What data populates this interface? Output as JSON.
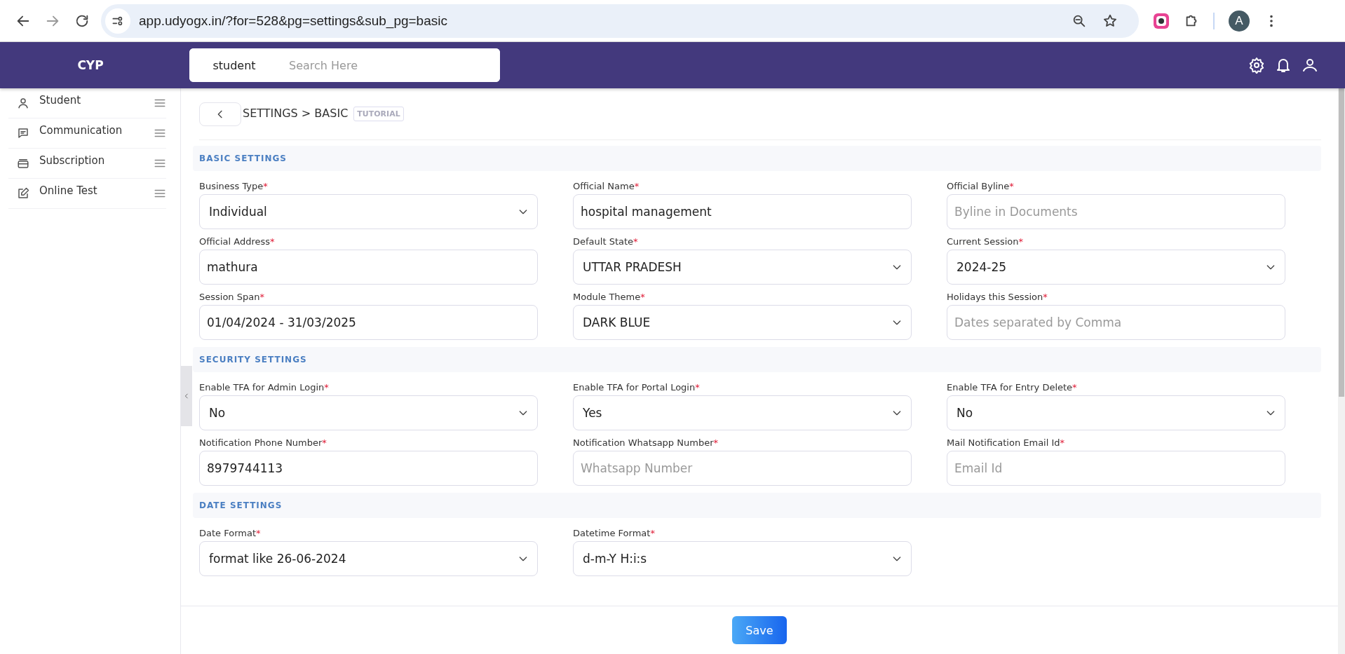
{
  "browser": {
    "url": "app.udyogx.in/?for=528&pg=settings&sub_pg=basic",
    "profile_initial": "A"
  },
  "header": {
    "brand": "CYP",
    "search_scope": "student",
    "search_placeholder": "Search Here"
  },
  "sidebar": {
    "items": [
      {
        "label": "Student"
      },
      {
        "label": "Communication"
      },
      {
        "label": "Subscription"
      },
      {
        "label": "Online Test"
      }
    ]
  },
  "breadcrumb": {
    "path": "SETTINGS > BASIC",
    "badge": "TUTORIAL"
  },
  "sections": [
    {
      "title": "BASIC SETTINGS",
      "fields": [
        {
          "label": "Business Type",
          "mark": "*",
          "kind": "select",
          "value": "Individual"
        },
        {
          "label": "Official Name",
          "mark": "*",
          "kind": "input",
          "value": "hospital management"
        },
        {
          "label": "Official Byline",
          "mark": "*",
          "kind": "input",
          "placeholder": "Byline in Documents"
        },
        {
          "label": "Official Address",
          "mark": "*",
          "kind": "input",
          "value": "mathura"
        },
        {
          "label": "Default State",
          "mark": "*",
          "kind": "select",
          "value": "UTTAR PRADESH"
        },
        {
          "label": "Current Session",
          "mark": "*",
          "kind": "select",
          "value": "2024-25"
        },
        {
          "label": "Session Span",
          "mark": "*",
          "kind": "input",
          "value": "01/04/2024 - 31/03/2025"
        },
        {
          "label": "Module Theme",
          "mark": "*",
          "kind": "select",
          "value": "DARK BLUE"
        },
        {
          "label": "Holidays this Session",
          "mark": "*",
          "kind": "input",
          "placeholder": "Dates separated by Comma"
        }
      ]
    },
    {
      "title": "SECURITY SETTINGS",
      "fields": [
        {
          "label": "Enable TFA for Admin Login",
          "mark": "*",
          "kind": "select",
          "value": "No"
        },
        {
          "label": "Enable TFA for Portal Login",
          "mark": "*",
          "kind": "select",
          "value": "Yes"
        },
        {
          "label": "Enable TFA for Entry Delete",
          "mark": "*",
          "kind": "select",
          "value": "No"
        },
        {
          "label": "Notification Phone Number",
          "mark": "*",
          "kind": "input",
          "value": "8979744113"
        },
        {
          "label": "Notification Whatsapp Number",
          "mark": "*",
          "kind": "input",
          "placeholder": "Whatsapp Number"
        },
        {
          "label": "Mail Notification Email Id",
          "mark": "*",
          "kind": "input",
          "placeholder": "Email Id"
        }
      ]
    },
    {
      "title": "DATE SETTINGS",
      "fields": [
        {
          "label": "Date Format",
          "mark": "*",
          "kind": "select",
          "value": "format like 26-06-2024"
        },
        {
          "label": "Datetime Format",
          "mark": "*",
          "kind": "select",
          "value": "d-m-Y H:i:s"
        }
      ]
    }
  ],
  "save_button": "Save"
}
